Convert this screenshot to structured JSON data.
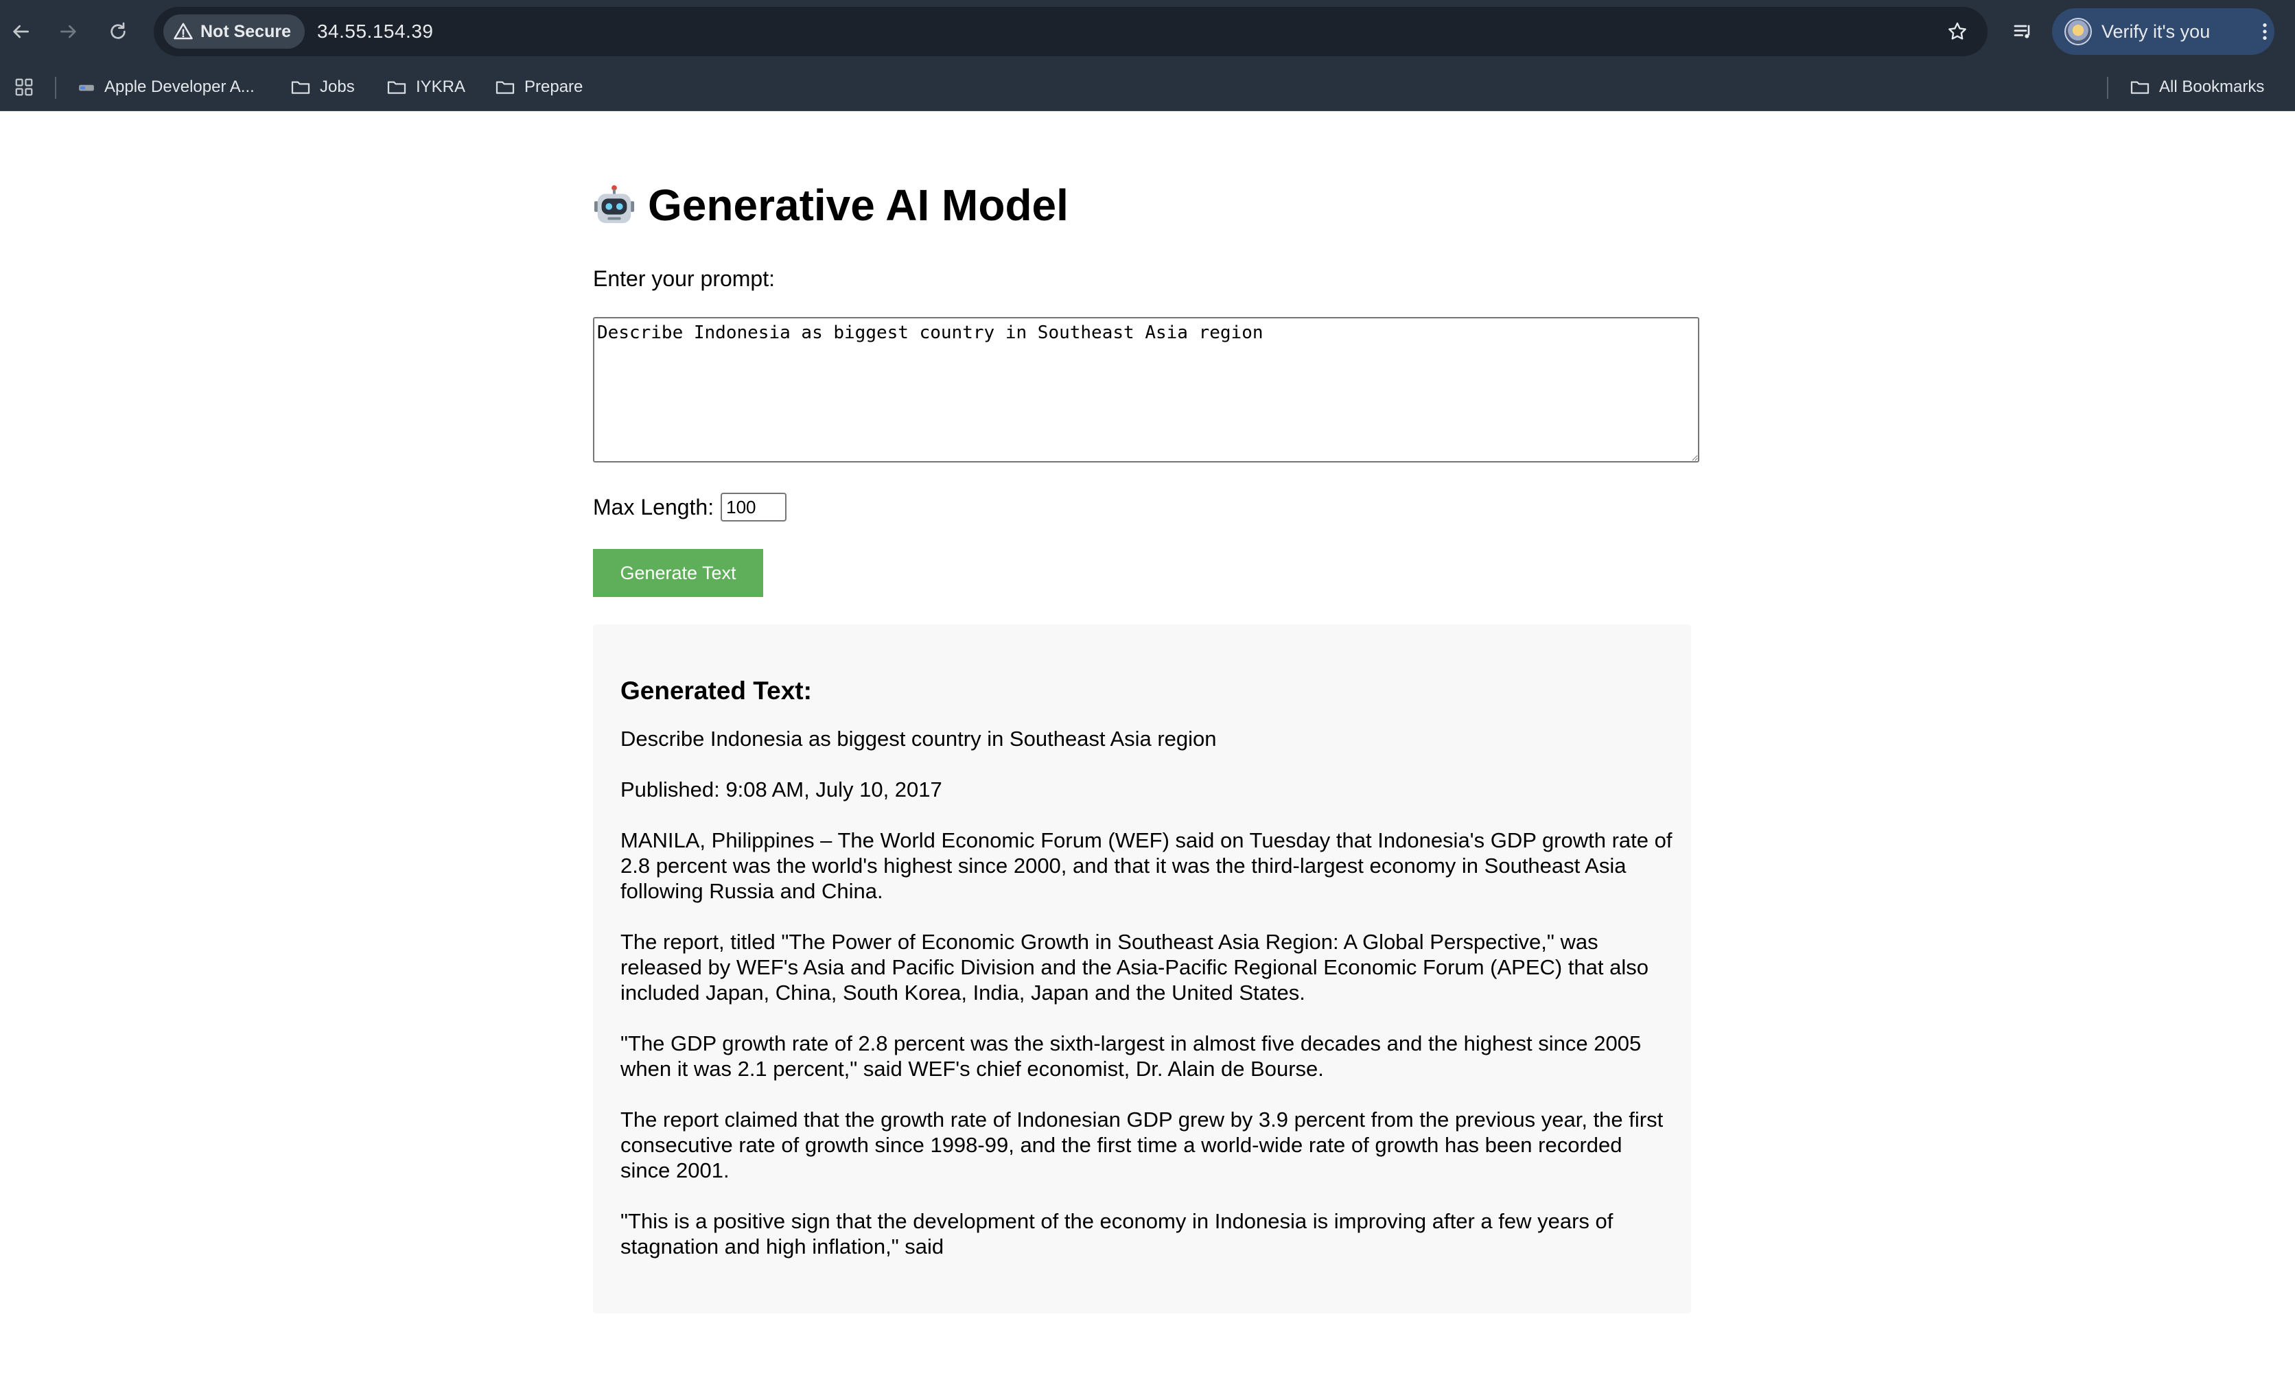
{
  "browser": {
    "security_label": "Not Secure",
    "url": "34.55.154.39",
    "profile_label": "Verify it's you",
    "bookmarks": [
      {
        "label": "Apple Developer A...",
        "icon": "apple-favicon-icon"
      },
      {
        "label": "Jobs",
        "icon": "folder-icon"
      },
      {
        "label": "IYKRA",
        "icon": "folder-icon"
      },
      {
        "label": "Prepare",
        "icon": "folder-icon"
      }
    ],
    "all_bookmarks_label": "All Bookmarks"
  },
  "page": {
    "title_emoji": "robot-icon",
    "title": "Generative AI Model",
    "prompt_label": "Enter your prompt:",
    "prompt_value": "Describe Indonesia as biggest country in Southeast Asia region",
    "max_length_label": "Max Length:",
    "max_length_value": "100",
    "generate_button": "Generate Text"
  },
  "output": {
    "heading": "Generated Text:",
    "paragraphs": [
      "Describe Indonesia as biggest country in Southeast Asia region",
      "Published: 9:08 AM, July 10, 2017",
      "MANILA, Philippines – The World Economic Forum (WEF) said on Tuesday that Indonesia's GDP growth rate of 2.8 percent was the world's highest since 2000, and that it was the third-largest economy in Southeast Asia following Russia and China.",
      "The report, titled \"The Power of Economic Growth in Southeast Asia Region: A Global Perspective,\" was released by WEF's Asia and Pacific Division and the Asia-Pacific Regional Economic Forum (APEC) that also included Japan, China, South Korea, India, Japan and the United States.",
      "\"The GDP growth rate of 2.8 percent was the sixth-largest in almost five decades and the highest since 2005 when it was 2.1 percent,\" said WEF's chief economist, Dr. Alain de Bourse.",
      "The report claimed that the growth rate of Indonesian GDP grew by 3.9 percent from the previous year, the first consecutive rate of growth since 1998-99, and the first time a world-wide rate of growth has been recorded since 2001.",
      "\"This is a positive sign that the development of the economy in Indonesia is improving after a few years of stagnation and high inflation,\" said"
    ]
  },
  "colors": {
    "chrome_bg": "#28323e",
    "omnibox_bg": "#1b222b",
    "profile_chip_bg": "#2f4a6e",
    "button_green": "#5fae5a",
    "output_bg": "#f8f8f8"
  }
}
